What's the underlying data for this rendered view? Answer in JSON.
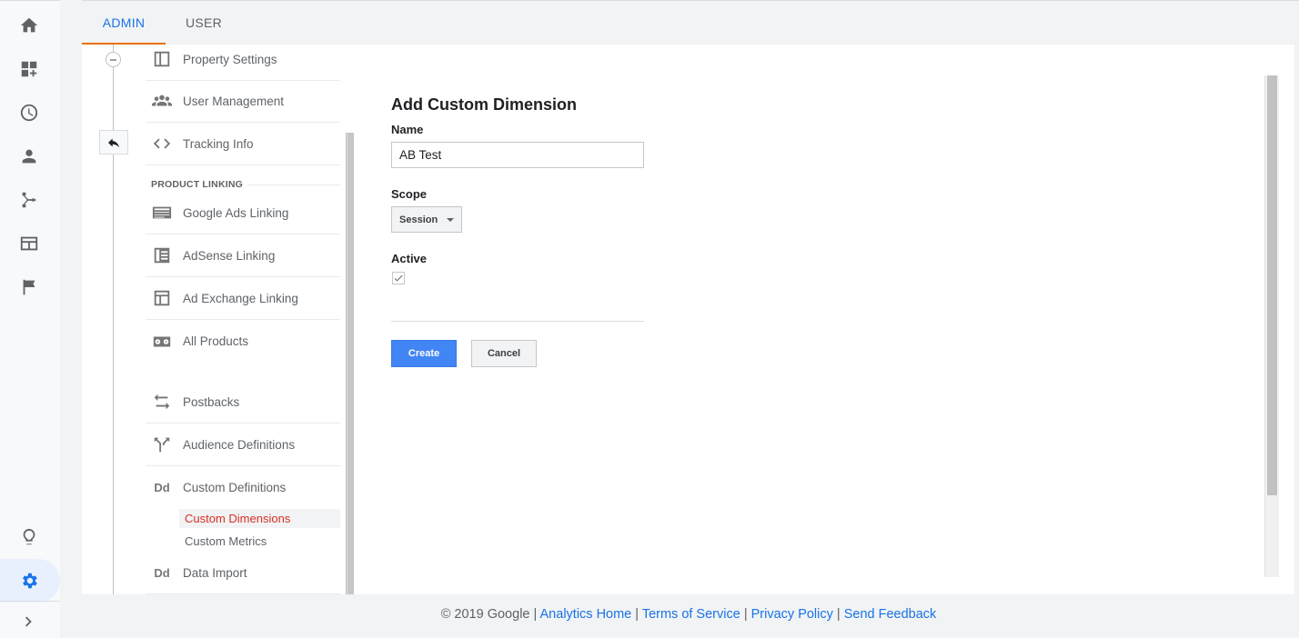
{
  "tabs": [
    {
      "label": "ADMIN"
    },
    {
      "label": "USER"
    }
  ],
  "rail": {
    "icons": [
      "home-icon",
      "customization-icon",
      "realtime-icon",
      "audience-icon",
      "acquisition-icon",
      "behavior-icon",
      "conversions-icon",
      "discover-icon",
      "admin-gear-icon",
      "expand-icon"
    ]
  },
  "nav": {
    "items": [
      {
        "label": "Property Settings",
        "icon": "property-settings-icon"
      },
      {
        "label": "User Management",
        "icon": "users-icon"
      },
      {
        "label": "Tracking Info",
        "icon": "code-icon"
      },
      {
        "label": "Google Ads Linking",
        "icon": "ads-icon"
      },
      {
        "label": "AdSense Linking",
        "icon": "adsense-icon"
      },
      {
        "label": "Ad Exchange Linking",
        "icon": "ad-exchange-icon"
      },
      {
        "label": "All Products",
        "icon": "link-icon"
      },
      {
        "label": "Postbacks",
        "icon": "postbacks-icon"
      },
      {
        "label": "Audience Definitions",
        "icon": "audience-fork-icon"
      },
      {
        "label": "Custom Definitions",
        "icon": "dd-icon"
      },
      {
        "label": "Data Import",
        "icon": "dd-icon"
      }
    ],
    "section_label": "PRODUCT LINKING",
    "sub_items": [
      {
        "label": "Custom Dimensions"
      },
      {
        "label": "Custom Metrics"
      }
    ],
    "dd_glyph": "Dd"
  },
  "form": {
    "title": "Add Custom Dimension",
    "name_label": "Name",
    "name_value": "AB Test",
    "scope_label": "Scope",
    "scope_value": "Session",
    "active_label": "Active",
    "active_checked": true,
    "create_label": "Create",
    "cancel_label": "Cancel"
  },
  "footer": {
    "copyright": "© 2019 Google",
    "sep": " | ",
    "links": [
      "Analytics Home",
      "Terms of Service",
      "Privacy Policy",
      "Send Feedback"
    ]
  },
  "colors": {
    "accent": "#1a73e8",
    "tab_underline": "#e8710a",
    "active_sub": "#d93025",
    "primary_button": "#4285f4"
  }
}
